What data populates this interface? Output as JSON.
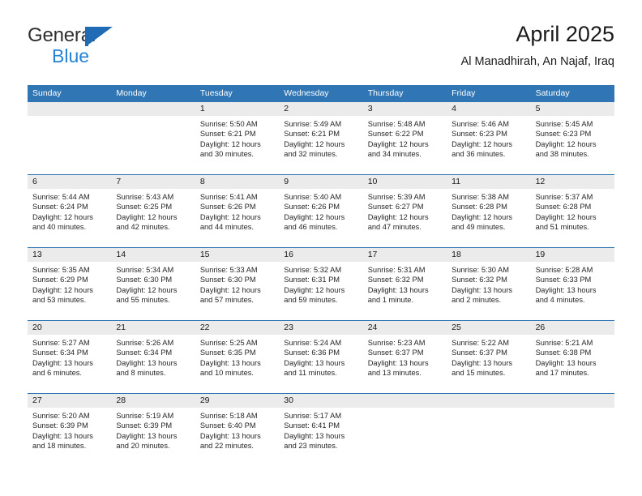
{
  "brand": {
    "name_top": "General",
    "name_bottom": "Blue",
    "mark": "triangle-flag-logo",
    "colors": {
      "blue": "#2583d6",
      "dark": "#2e2e2e"
    }
  },
  "header": {
    "title": "April 2025",
    "subtitle": "Al Manadhirah, An Najaf, Iraq"
  },
  "theme": {
    "header_blue": "#3075b4",
    "daynum_band": "#ebebeb",
    "text": "#262626"
  },
  "calendar": {
    "weekdays": [
      "Sunday",
      "Monday",
      "Tuesday",
      "Wednesday",
      "Thursday",
      "Friday",
      "Saturday"
    ],
    "weeks": [
      {
        "days": [
          {
            "num": "",
            "lines": [
              "",
              "",
              "",
              ""
            ]
          },
          {
            "num": "",
            "lines": [
              "",
              "",
              "",
              ""
            ]
          },
          {
            "num": "1",
            "lines": [
              "Sunrise: 5:50 AM",
              "Sunset: 6:21 PM",
              "Daylight: 12 hours",
              "and 30 minutes."
            ]
          },
          {
            "num": "2",
            "lines": [
              "Sunrise: 5:49 AM",
              "Sunset: 6:21 PM",
              "Daylight: 12 hours",
              "and 32 minutes."
            ]
          },
          {
            "num": "3",
            "lines": [
              "Sunrise: 5:48 AM",
              "Sunset: 6:22 PM",
              "Daylight: 12 hours",
              "and 34 minutes."
            ]
          },
          {
            "num": "4",
            "lines": [
              "Sunrise: 5:46 AM",
              "Sunset: 6:23 PM",
              "Daylight: 12 hours",
              "and 36 minutes."
            ]
          },
          {
            "num": "5",
            "lines": [
              "Sunrise: 5:45 AM",
              "Sunset: 6:23 PM",
              "Daylight: 12 hours",
              "and 38 minutes."
            ]
          }
        ]
      },
      {
        "days": [
          {
            "num": "6",
            "lines": [
              "Sunrise: 5:44 AM",
              "Sunset: 6:24 PM",
              "Daylight: 12 hours",
              "and 40 minutes."
            ]
          },
          {
            "num": "7",
            "lines": [
              "Sunrise: 5:43 AM",
              "Sunset: 6:25 PM",
              "Daylight: 12 hours",
              "and 42 minutes."
            ]
          },
          {
            "num": "8",
            "lines": [
              "Sunrise: 5:41 AM",
              "Sunset: 6:26 PM",
              "Daylight: 12 hours",
              "and 44 minutes."
            ]
          },
          {
            "num": "9",
            "lines": [
              "Sunrise: 5:40 AM",
              "Sunset: 6:26 PM",
              "Daylight: 12 hours",
              "and 46 minutes."
            ]
          },
          {
            "num": "10",
            "lines": [
              "Sunrise: 5:39 AM",
              "Sunset: 6:27 PM",
              "Daylight: 12 hours",
              "and 47 minutes."
            ]
          },
          {
            "num": "11",
            "lines": [
              "Sunrise: 5:38 AM",
              "Sunset: 6:28 PM",
              "Daylight: 12 hours",
              "and 49 minutes."
            ]
          },
          {
            "num": "12",
            "lines": [
              "Sunrise: 5:37 AM",
              "Sunset: 6:28 PM",
              "Daylight: 12 hours",
              "and 51 minutes."
            ]
          }
        ]
      },
      {
        "days": [
          {
            "num": "13",
            "lines": [
              "Sunrise: 5:35 AM",
              "Sunset: 6:29 PM",
              "Daylight: 12 hours",
              "and 53 minutes."
            ]
          },
          {
            "num": "14",
            "lines": [
              "Sunrise: 5:34 AM",
              "Sunset: 6:30 PM",
              "Daylight: 12 hours",
              "and 55 minutes."
            ]
          },
          {
            "num": "15",
            "lines": [
              "Sunrise: 5:33 AM",
              "Sunset: 6:30 PM",
              "Daylight: 12 hours",
              "and 57 minutes."
            ]
          },
          {
            "num": "16",
            "lines": [
              "Sunrise: 5:32 AM",
              "Sunset: 6:31 PM",
              "Daylight: 12 hours",
              "and 59 minutes."
            ]
          },
          {
            "num": "17",
            "lines": [
              "Sunrise: 5:31 AM",
              "Sunset: 6:32 PM",
              "Daylight: 13 hours",
              "and 1 minute."
            ]
          },
          {
            "num": "18",
            "lines": [
              "Sunrise: 5:30 AM",
              "Sunset: 6:32 PM",
              "Daylight: 13 hours",
              "and 2 minutes."
            ]
          },
          {
            "num": "19",
            "lines": [
              "Sunrise: 5:28 AM",
              "Sunset: 6:33 PM",
              "Daylight: 13 hours",
              "and 4 minutes."
            ]
          }
        ]
      },
      {
        "days": [
          {
            "num": "20",
            "lines": [
              "Sunrise: 5:27 AM",
              "Sunset: 6:34 PM",
              "Daylight: 13 hours",
              "and 6 minutes."
            ]
          },
          {
            "num": "21",
            "lines": [
              "Sunrise: 5:26 AM",
              "Sunset: 6:34 PM",
              "Daylight: 13 hours",
              "and 8 minutes."
            ]
          },
          {
            "num": "22",
            "lines": [
              "Sunrise: 5:25 AM",
              "Sunset: 6:35 PM",
              "Daylight: 13 hours",
              "and 10 minutes."
            ]
          },
          {
            "num": "23",
            "lines": [
              "Sunrise: 5:24 AM",
              "Sunset: 6:36 PM",
              "Daylight: 13 hours",
              "and 11 minutes."
            ]
          },
          {
            "num": "24",
            "lines": [
              "Sunrise: 5:23 AM",
              "Sunset: 6:37 PM",
              "Daylight: 13 hours",
              "and 13 minutes."
            ]
          },
          {
            "num": "25",
            "lines": [
              "Sunrise: 5:22 AM",
              "Sunset: 6:37 PM",
              "Daylight: 13 hours",
              "and 15 minutes."
            ]
          },
          {
            "num": "26",
            "lines": [
              "Sunrise: 5:21 AM",
              "Sunset: 6:38 PM",
              "Daylight: 13 hours",
              "and 17 minutes."
            ]
          }
        ]
      },
      {
        "days": [
          {
            "num": "27",
            "lines": [
              "Sunrise: 5:20 AM",
              "Sunset: 6:39 PM",
              "Daylight: 13 hours",
              "and 18 minutes."
            ]
          },
          {
            "num": "28",
            "lines": [
              "Sunrise: 5:19 AM",
              "Sunset: 6:39 PM",
              "Daylight: 13 hours",
              "and 20 minutes."
            ]
          },
          {
            "num": "29",
            "lines": [
              "Sunrise: 5:18 AM",
              "Sunset: 6:40 PM",
              "Daylight: 13 hours",
              "and 22 minutes."
            ]
          },
          {
            "num": "30",
            "lines": [
              "Sunrise: 5:17 AM",
              "Sunset: 6:41 PM",
              "Daylight: 13 hours",
              "and 23 minutes."
            ]
          },
          {
            "num": "",
            "lines": [
              "",
              "",
              "",
              ""
            ]
          },
          {
            "num": "",
            "lines": [
              "",
              "",
              "",
              ""
            ]
          },
          {
            "num": "",
            "lines": [
              "",
              "",
              "",
              ""
            ]
          }
        ]
      }
    ]
  }
}
